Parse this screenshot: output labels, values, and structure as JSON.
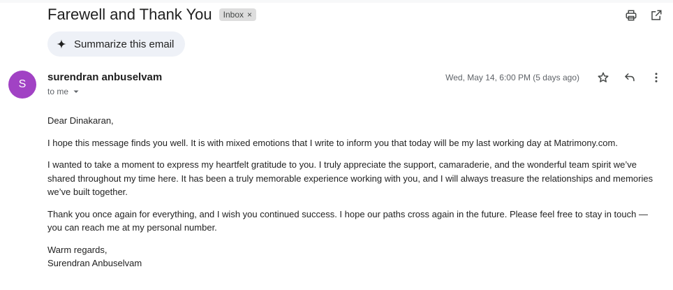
{
  "email": {
    "subject": "Farewell and Thank You",
    "label": "Inbox",
    "label_remove": "×",
    "summarize_label": "Summarize this email",
    "sender_initial": "S",
    "sender_name": "surendran anbuselvam",
    "recipient": "to me",
    "date": "Wed, May 14, 6:00 PM (5 days ago)",
    "body": {
      "greeting": "Dear Dinakaran,",
      "paragraphs": [
        "I hope this message finds you well. It is with mixed emotions that I write to inform you that today will be my last working day at Matrimony.com.",
        "I wanted to take a moment to express my heartfelt gratitude to you. I truly appreciate the support, camaraderie, and the wonderful team spirit we’ve shared throughout my time here. It has been a truly memorable experience working with you, and I will always treasure the relationships and memories we’ve built together.",
        "Thank you once again for everything, and I wish you continued success. I hope our paths cross again in the future. Please feel free to stay in touch — you can reach me at my personal number."
      ],
      "closing": "Warm regards,",
      "signature": "Surendran Anbuselvam"
    }
  },
  "icons": {
    "print": "print-icon",
    "open_new_window": "open-in-new-icon",
    "sparkle": "sparkle-icon",
    "star": "star-icon",
    "reply": "reply-icon",
    "more": "more-vert-icon",
    "expand": "caret-down-icon"
  },
  "colors": {
    "avatar": "#a142c4",
    "summarize_bg": "#eef1f7",
    "label_bg": "#dddddd",
    "muted_text": "#5f6368"
  }
}
